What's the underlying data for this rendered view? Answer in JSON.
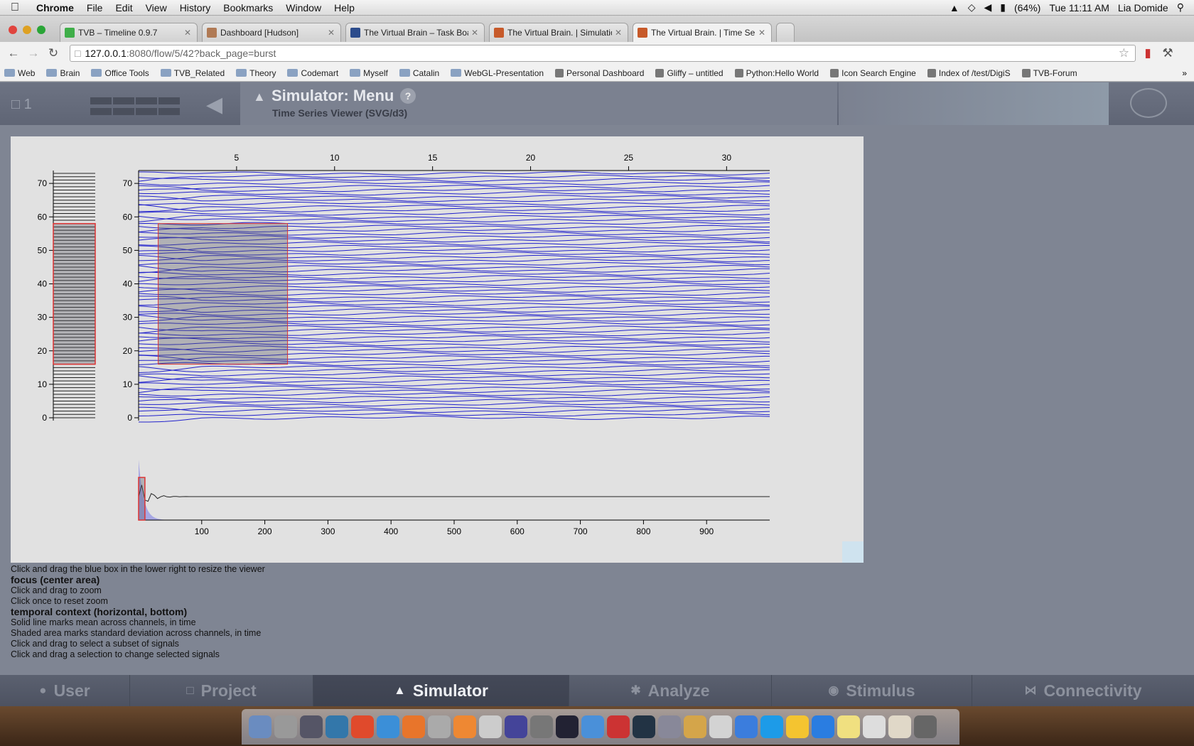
{
  "menubar": {
    "app": "Chrome",
    "menus": [
      "File",
      "Edit",
      "View",
      "History",
      "Bookmarks",
      "Window",
      "Help"
    ],
    "battery": "(64%)",
    "clock": "Tue 11:11 AM",
    "user": "Lia Domide"
  },
  "tabs": [
    {
      "title": "TVB – Timeline 0.9.7",
      "fav_color": "#3fae49"
    },
    {
      "title": "Dashboard [Hudson]",
      "fav_color": "#b07a55"
    },
    {
      "title": "The Virtual Brain – Task Boar",
      "fav_color": "#2c4c8c"
    },
    {
      "title": "The Virtual Brain. | Simulatio",
      "fav_color": "#c75a2a"
    },
    {
      "title": "The Virtual Brain. | Time Seri",
      "fav_color": "#c75a2a"
    }
  ],
  "address": {
    "host": "127.0.0.1",
    "path": ":8080/flow/5/42?back_page=burst"
  },
  "bookmarks": [
    "Web",
    "Brain",
    "Office Tools",
    "TVB_Related",
    "Theory",
    "Codemart",
    "Myself",
    "Catalin",
    "WebGL-Presentation",
    "Personal Dashboard",
    "Gliffy – untitled",
    "Python:Hello World",
    "Icon Search Engine",
    "Index of /test/DigiS",
    "TVB-Forum"
  ],
  "tvb_header": {
    "project_count": "1",
    "title": "Simulator: Menu",
    "subtitle": "Time Series Viewer (SVG/d3)",
    "help": "?"
  },
  "chart_data": [
    {
      "type": "line",
      "name": "focus",
      "x_ticks": [
        5,
        10,
        15,
        20,
        25,
        30
      ],
      "y_ticks": [
        0,
        10,
        20,
        30,
        40,
        50,
        60,
        70
      ],
      "xlim": [
        0,
        32.2
      ],
      "ylim": [
        0,
        73
      ],
      "channel_count": 74,
      "line_color": "#2222cc",
      "selection": {
        "x": [
          1,
          7.6
        ],
        "y": [
          16,
          58
        ]
      }
    },
    {
      "type": "line",
      "name": "channel-context",
      "y_ticks": [
        0,
        10,
        20,
        30,
        40,
        50,
        60,
        70
      ],
      "ylim": [
        0,
        73
      ],
      "selection": {
        "y": [
          16,
          58
        ]
      }
    },
    {
      "type": "area",
      "name": "temporal-context",
      "x_ticks": [
        100,
        200,
        300,
        400,
        500,
        600,
        700,
        800,
        900
      ],
      "xlim": [
        0,
        1000
      ],
      "selection": {
        "x": [
          0,
          10
        ]
      }
    }
  ],
  "help": {
    "resize": "Click and drag the blue box in the lower right to resize the viewer",
    "focus_heading": "focus (center area)",
    "focus_1": "Click and drag to zoom",
    "focus_2": "Click once to reset zoom",
    "temporal_heading": "temporal context (horizontal, bottom)",
    "temporal_1": "Solid line marks mean across channels, in time",
    "temporal_2": "Shaded area marks standard deviation across channels, in time",
    "temporal_3": "Click and drag to select a subset of signals",
    "temporal_4": "Click and drag a selection to change selected signals"
  },
  "bottom_nav": [
    {
      "label": "User",
      "icon": "user-icon"
    },
    {
      "label": "Project",
      "icon": "document-icon"
    },
    {
      "label": "Simulator",
      "icon": "rocket-icon"
    },
    {
      "label": "Analyze",
      "icon": "gear-icon"
    },
    {
      "label": "Stimulus",
      "icon": "pin-icon"
    },
    {
      "label": "Connectivity",
      "icon": "connectivity-icon"
    }
  ],
  "dock_colors": [
    "#6a8cc0",
    "#999",
    "#556",
    "#3377aa",
    "#e04a2c",
    "#3b8fd8",
    "#e8752b",
    "#aaa",
    "#ee8833",
    "#ccc",
    "#449",
    "#777",
    "#223",
    "#4a90d9",
    "#c33",
    "#234",
    "#889",
    "#d4a54a",
    "#d3d3d3",
    "#3b7ddd",
    "#1d9be8",
    "#f4c430",
    "#2a7de1",
    "#f0e080",
    "#ddd",
    "#e0d8c8",
    "#666"
  ]
}
